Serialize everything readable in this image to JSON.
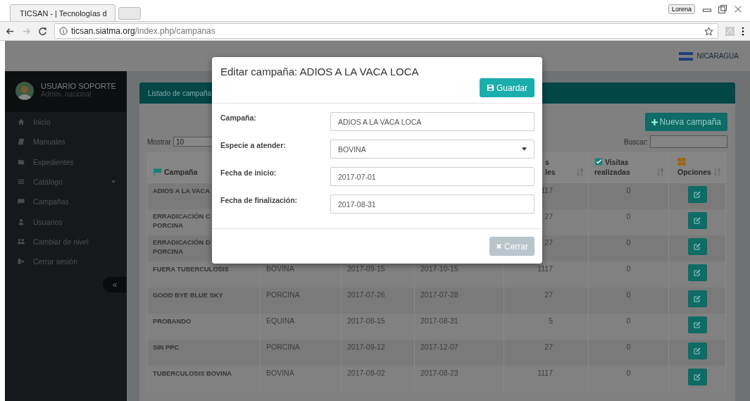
{
  "browser": {
    "tab_title": "TICSAN - | Tecnologías d",
    "profile": "Lorena",
    "url_host": "ticsan.siatma.org",
    "url_path": "/index.php/campanas"
  },
  "header": {
    "country": "NICARAGUA"
  },
  "sidebar": {
    "user_name": "USUARIO SOPORTE",
    "user_role": "Admin. nacional",
    "collapse": "«",
    "items": [
      {
        "label": "Inicio",
        "expandable": false
      },
      {
        "label": "Manuales",
        "expandable": false
      },
      {
        "label": "Expedientes",
        "expandable": false
      },
      {
        "label": "Catálogo",
        "expandable": true
      },
      {
        "label": "Campañas",
        "expandable": false
      },
      {
        "label": "Usuarios",
        "expandable": false
      },
      {
        "label": "Cambiar de nivel",
        "expandable": false
      },
      {
        "label": "Cerrar sesión",
        "expandable": false
      }
    ]
  },
  "card": {
    "title": "Listado de campaña",
    "new_button": "Nueva campaña",
    "show_label": "Mostrar",
    "page_size": "10",
    "search_label": "Buscar:"
  },
  "table": {
    "columns": [
      {
        "lines": [
          "Campaña"
        ]
      },
      {},
      {},
      {},
      {
        "lines": [
          "s",
          "les"
        ],
        "sortable": true
      },
      {
        "lines": [
          "Visitas",
          "realizadas"
        ],
        "sortable": true
      },
      {
        "lines": [
          "Opciones"
        ],
        "sortable": true
      }
    ],
    "rows": [
      {
        "name_lines": [
          "ADIOS A LA VACA"
        ],
        "total": "117",
        "visits": "0"
      },
      {
        "name_lines": [
          "ERRADICACIÓN C",
          "PORCINA"
        ],
        "total": "27",
        "visits": "0"
      },
      {
        "name_lines": [
          "ERRADICACIÓN D",
          "PORCINA"
        ],
        "total": "27",
        "visits": "0"
      },
      {
        "name_lines": [
          "FUERA TUBERCULOSIS"
        ],
        "species": "BOVINA",
        "start": "2017-09-15",
        "end": "2017-10-15",
        "total": "1117",
        "visits": "0"
      },
      {
        "name_lines": [
          "GOOD BYE BLUE SKY"
        ],
        "species": "PORCINA",
        "start": "2017-07-26",
        "end": "2017-07-28",
        "total": "27",
        "visits": "0"
      },
      {
        "name_lines": [
          "PROBANDO"
        ],
        "species": "EQUINA",
        "start": "2017-08-15",
        "end": "2017-08-31",
        "total": "5",
        "visits": "0"
      },
      {
        "name_lines": [
          "SIN PPC"
        ],
        "species": "PORCINA",
        "start": "2017-09-12",
        "end": "2017-12-07",
        "total": "27",
        "visits": "0"
      },
      {
        "name_lines": [
          "TUBERCULOSIS BOVINA"
        ],
        "species": "BOVINA",
        "start": "2017-08-02",
        "end": "2017-08-23",
        "total": "1117",
        "visits": "0"
      }
    ]
  },
  "modal": {
    "title": "Editar campaña: ADIOS A LA VACA LOCA",
    "save": "Guardar",
    "fields": [
      {
        "label": "Campaña:",
        "kind": "text",
        "value": "ADIOS A LA VACA LOCA"
      },
      {
        "label": "Especie a atender:",
        "kind": "select",
        "value": "BOVINA"
      },
      {
        "label": "Fecha de inicio:",
        "kind": "text",
        "value": "2017-07-01"
      },
      {
        "label": "Fecha de finalización:",
        "kind": "text",
        "value": "2017-08-31"
      }
    ],
    "close": {
      "label": "Cerrar",
      "disabled": true
    }
  }
}
